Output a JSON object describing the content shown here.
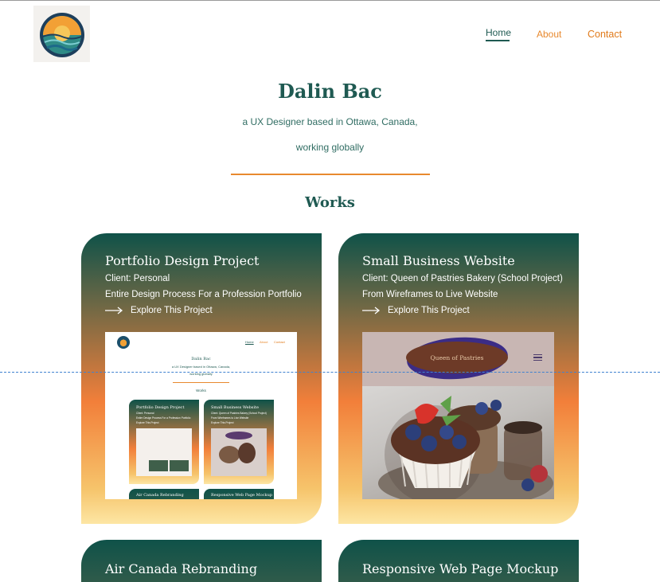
{
  "header": {
    "nav": {
      "home": "Home",
      "about": "About",
      "contact": "Contact"
    }
  },
  "hero": {
    "name": "Dalin Bac",
    "tagline_line1": "a UX Designer based in Ottawa, Canada,",
    "tagline_line2": "working globally"
  },
  "works": {
    "heading": "Works",
    "explore_label": "Explore This Project",
    "projects": [
      {
        "title": "Portfolio Design Project",
        "client": "Client: Personal",
        "description": "Entire Design Process For a Profession Portfolio"
      },
      {
        "title": "Small Business Website",
        "client": "Client: Queen of Pastries Bakery (School Project)",
        "description": "From Wireframes to Live Website"
      },
      {
        "title": "Air Canada Rebranding"
      },
      {
        "title": "Responsive Web Page Mockup"
      }
    ]
  },
  "mini_site": {
    "nav_home": "Home",
    "nav_about": "About",
    "nav_contact": "Contact",
    "name": "Dalin Bac",
    "tagline_line1": "a UX Designer based in Ottawa, Canada,",
    "tagline_line2": "working globally",
    "works": "Works",
    "card1_title": "Portfolio Design Project",
    "card1_client": "Client: Personal",
    "card1_desc": "Entire Design Process For a Profession Portfolio",
    "card2_title": "Small Business Website",
    "card2_client": "Client: Queen of Pastries Bakery (School Project)",
    "card2_desc": "From Wireframes to Live Website",
    "explore": "Explore This Project",
    "card3_title": "Air Canada Rebranding",
    "card4_title": "Responsive Web Page Mockup"
  },
  "pastry_thumb": {
    "brand": "Queen of Pastries"
  },
  "colors": {
    "teal": "#1f5a52",
    "orange": "#e8892e",
    "guide": "#3f82d0"
  }
}
